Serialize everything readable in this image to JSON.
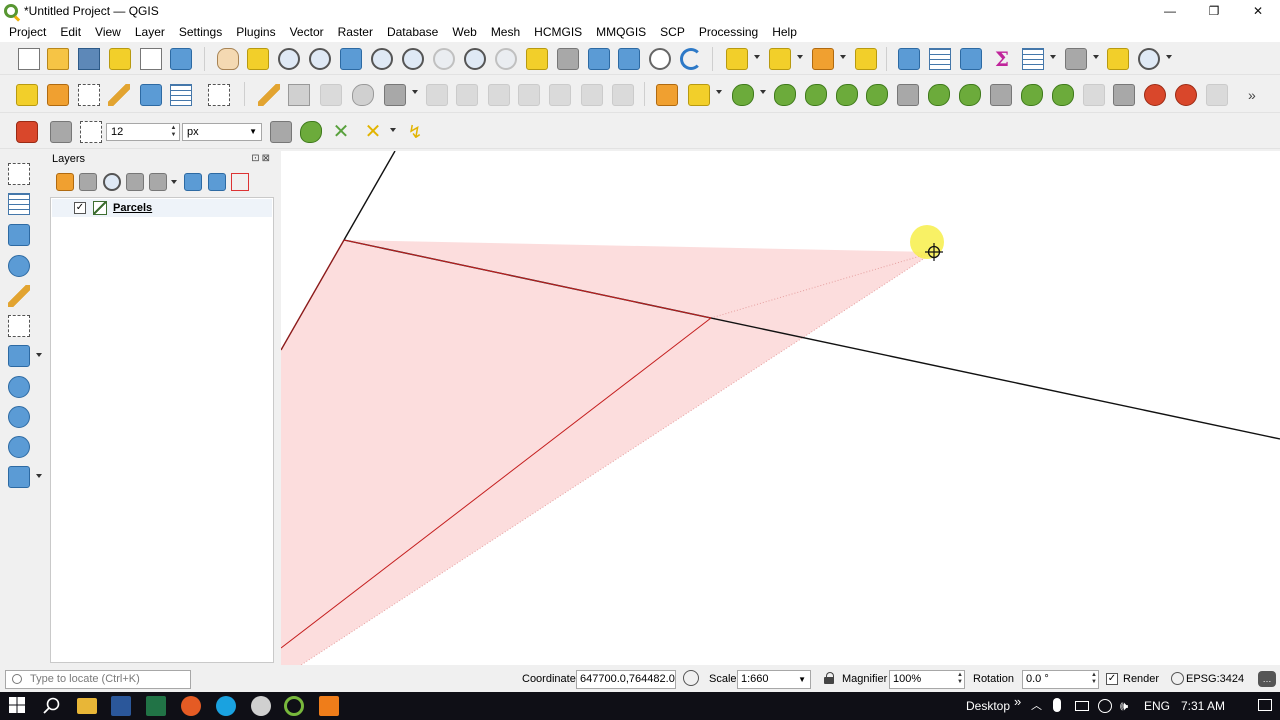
{
  "window": {
    "title": "*Untitled Project — QGIS",
    "controls": [
      "—",
      "❐",
      "✕"
    ]
  },
  "menu": [
    "Project",
    "Edit",
    "View",
    "Layer",
    "Settings",
    "Plugins",
    "Vector",
    "Raster",
    "Database",
    "Web",
    "Mesh",
    "HCMGIS",
    "MMQGIS",
    "SCP",
    "Processing",
    "Help"
  ],
  "snapping": {
    "tolerance": "12",
    "units": "px"
  },
  "layers_panel": {
    "title": "Layers",
    "header_buttons": "⊡⊠",
    "layers": [
      {
        "name": "Parcels",
        "checked": "✓"
      }
    ]
  },
  "statusbar": {
    "locate_placeholder": "Type to locate (Ctrl+K)",
    "coordinate_label": "Coordinate",
    "coordinate_value": "647700.0,764482.0",
    "scale_label": "Scale",
    "scale_value": "1:660",
    "magnifier_label": "Magnifier",
    "magnifier_value": "100%",
    "rotation_label": "Rotation",
    "rotation_value": "0.0 °",
    "render_label": "Render",
    "render_checked": "✓",
    "crs": "EPSG:3424"
  },
  "taskbar": {
    "desktop_label": "Desktop",
    "chevron": "»",
    "language": "ENG",
    "time": "7:31 AM"
  },
  "colors": {
    "polygon_fill": "#fcd9d9",
    "polygon_edge": "#c41e1e",
    "cursor_highlight": "#f7ee4a",
    "taskbar_bg": "#0f0f16"
  }
}
